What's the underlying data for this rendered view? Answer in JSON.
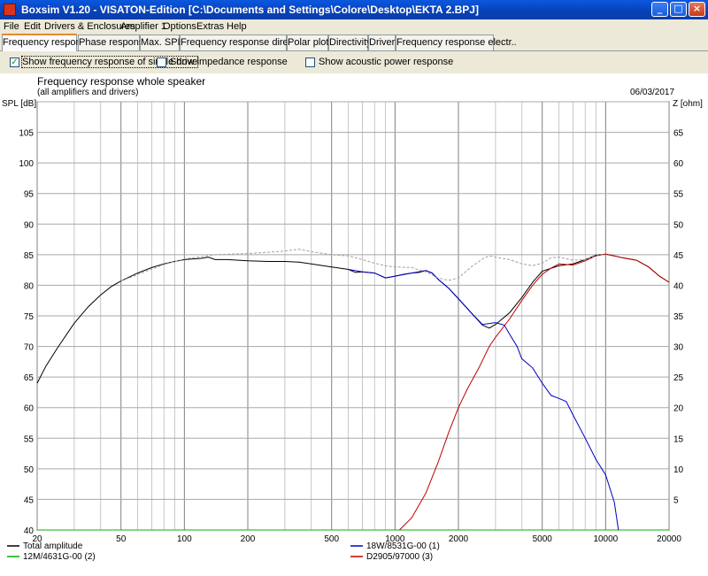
{
  "window": {
    "title": "Boxsim V1.20 - VISATON-Edition [C:\\Documents and Settings\\Colore\\Desktop\\EKTA 2.BPJ]",
    "minimize_label": "_",
    "maximize_label": "□",
    "close_label": "×"
  },
  "menu": [
    "File",
    "Edit",
    "Drivers & Enclosures",
    "Amplifier 1",
    "Options",
    "Extras",
    "Help"
  ],
  "tabs": [
    "Frequency response.",
    "Phase response",
    "Max. SPL",
    "Frequency response directions",
    "Polar plots",
    "Directivity",
    "Driver",
    "Frequency response electr.."
  ],
  "active_tab": 0,
  "options": [
    {
      "label": "Show frequency response of single drive",
      "checked": true
    },
    {
      "label": "Show impedance response",
      "checked": false
    },
    {
      "label": "Show acoustic power response",
      "checked": false
    }
  ],
  "chart_data": {
    "type": "line",
    "title": "Frequency response whole speaker",
    "subtitle": "(all amplifiers and drivers)",
    "date": "06/03/2017",
    "ylabel": "SPL [dB]",
    "ylabel_right": "Z [ohm]",
    "xscale": "log",
    "xlim": [
      20,
      20000
    ],
    "ylim": [
      40,
      110
    ],
    "ylim_right": [
      0,
      70
    ],
    "x_ticks": [
      20,
      50,
      100,
      200,
      500,
      1000,
      2000,
      5000,
      10000,
      20000
    ],
    "y_ticks": [
      40,
      45,
      50,
      55,
      60,
      65,
      70,
      75,
      80,
      85,
      90,
      95,
      100,
      105
    ],
    "y_ticks_right": [
      5,
      10,
      15,
      20,
      25,
      30,
      35,
      40,
      45,
      50,
      55,
      60,
      65
    ],
    "grid": true,
    "series": [
      {
        "name": "Total amplitude",
        "color": "#000000",
        "dash": false,
        "points": [
          [
            20,
            64
          ],
          [
            22,
            66.8
          ],
          [
            25,
            69.8
          ],
          [
            28,
            72.3
          ],
          [
            30,
            73.8
          ],
          [
            35,
            76.5
          ],
          [
            40,
            78.4
          ],
          [
            45,
            79.8
          ],
          [
            50,
            80.7
          ],
          [
            60,
            82
          ],
          [
            70,
            82.9
          ],
          [
            80,
            83.5
          ],
          [
            90,
            83.9
          ],
          [
            100,
            84.2
          ],
          [
            120,
            84.4
          ],
          [
            130,
            84.6
          ],
          [
            140,
            84.2
          ],
          [
            160,
            84.2
          ],
          [
            200,
            84
          ],
          [
            250,
            83.9
          ],
          [
            300,
            83.9
          ],
          [
            350,
            83.8
          ],
          [
            400,
            83.5
          ],
          [
            500,
            83
          ],
          [
            600,
            82.6
          ],
          [
            650,
            82.1
          ],
          [
            700,
            82.2
          ],
          [
            800,
            82
          ],
          [
            900,
            81.2
          ],
          [
            1000,
            81.5
          ],
          [
            1100,
            81.8
          ],
          [
            1200,
            82
          ],
          [
            1300,
            82.1
          ],
          [
            1400,
            82.4
          ],
          [
            1500,
            82
          ],
          [
            1600,
            81
          ],
          [
            1800,
            79.5
          ],
          [
            2000,
            77.8
          ],
          [
            2300,
            75.5
          ],
          [
            2600,
            73.5
          ],
          [
            2800,
            73
          ],
          [
            3000,
            73.6
          ],
          [
            3500,
            75.5
          ],
          [
            4000,
            78
          ],
          [
            4500,
            80.5
          ],
          [
            5000,
            82.3
          ],
          [
            6000,
            83.2
          ],
          [
            7000,
            83.5
          ],
          [
            8000,
            84.2
          ],
          [
            9000,
            84.9
          ],
          [
            10000,
            85.1
          ],
          [
            11000,
            84.8
          ],
          [
            12000,
            84.5
          ],
          [
            14000,
            84.1
          ],
          [
            16000,
            83
          ],
          [
            18000,
            81.5
          ],
          [
            20000,
            80.5
          ]
        ]
      },
      {
        "name": "12M/4631G-00 (2)",
        "color": "#00b000",
        "dash": false,
        "points": [
          [
            20,
            40
          ],
          [
            20000,
            40
          ]
        ]
      },
      {
        "name": "18W/8531G-00 (1)",
        "color": "#0000c0",
        "dash": false,
        "points": [
          [
            600,
            82.6
          ],
          [
            700,
            82.2
          ],
          [
            800,
            82
          ],
          [
            900,
            81.2
          ],
          [
            1000,
            81.5
          ],
          [
            1200,
            82
          ],
          [
            1400,
            82.4
          ],
          [
            1500,
            82
          ],
          [
            1600,
            81
          ],
          [
            1800,
            79.5
          ],
          [
            2000,
            77.8
          ],
          [
            2300,
            75.5
          ],
          [
            2600,
            73.6
          ],
          [
            3000,
            73.9
          ],
          [
            3300,
            73.5
          ],
          [
            3500,
            72
          ],
          [
            3800,
            70
          ],
          [
            4000,
            68
          ],
          [
            4500,
            66.5
          ],
          [
            5000,
            64
          ],
          [
            5500,
            62
          ],
          [
            6000,
            61.5
          ],
          [
            6500,
            61
          ],
          [
            7000,
            58.8
          ],
          [
            8000,
            55
          ],
          [
            9000,
            51.5
          ],
          [
            10000,
            49
          ],
          [
            11000,
            44.5
          ],
          [
            11500,
            40
          ]
        ]
      },
      {
        "name": "D2905/97000 (3)",
        "color": "#c00000",
        "dash": false,
        "points": [
          [
            1050,
            40
          ],
          [
            1200,
            42
          ],
          [
            1400,
            46
          ],
          [
            1600,
            51
          ],
          [
            1800,
            56
          ],
          [
            2000,
            60
          ],
          [
            2200,
            63
          ],
          [
            2500,
            66.5
          ],
          [
            2800,
            70
          ],
          [
            3000,
            71.5
          ],
          [
            3500,
            74.5
          ],
          [
            4000,
            77.5
          ],
          [
            4500,
            80
          ],
          [
            5000,
            81.8
          ],
          [
            5500,
            82.8
          ],
          [
            6000,
            83.5
          ],
          [
            7000,
            83.3
          ],
          [
            8000,
            84
          ],
          [
            9000,
            84.8
          ],
          [
            10000,
            85.1
          ],
          [
            11000,
            84.8
          ],
          [
            12000,
            84.5
          ],
          [
            14000,
            84.1
          ],
          [
            16000,
            83
          ],
          [
            18000,
            81.5
          ],
          [
            20000,
            80.5
          ]
        ]
      },
      {
        "name": "",
        "color": "#a0a0a0",
        "dash": true,
        "points": [
          [
            50,
            80.7
          ],
          [
            80,
            83.4
          ],
          [
            100,
            84.3
          ],
          [
            140,
            85
          ],
          [
            200,
            85.2
          ],
          [
            250,
            85.4
          ],
          [
            300,
            85.6
          ],
          [
            350,
            85.9
          ],
          [
            400,
            85.5
          ],
          [
            500,
            85
          ],
          [
            600,
            84.8
          ],
          [
            700,
            84.2
          ],
          [
            800,
            83.6
          ],
          [
            900,
            83.2
          ],
          [
            1000,
            83
          ],
          [
            1200,
            82.9
          ],
          [
            1400,
            82.2
          ],
          [
            1600,
            81.2
          ],
          [
            1800,
            80.8
          ],
          [
            2000,
            81.2
          ],
          [
            2300,
            83
          ],
          [
            2600,
            84.3
          ],
          [
            2800,
            84.8
          ],
          [
            3000,
            84.6
          ],
          [
            3500,
            84.2
          ],
          [
            4000,
            83.5
          ],
          [
            4500,
            83.2
          ],
          [
            5000,
            83.6
          ],
          [
            5500,
            84.5
          ],
          [
            6000,
            84.6
          ],
          [
            7000,
            84.1
          ],
          [
            8000,
            84.2
          ],
          [
            9000,
            84.8
          ],
          [
            10000,
            85.1
          ]
        ]
      }
    ],
    "legend": [
      {
        "name": "Total amplitude",
        "color": "#000000"
      },
      {
        "name": "12M/4631G-00 (2)",
        "color": "#00b000"
      },
      {
        "name": "18W/8531G-00 (1)",
        "color": "#0000c0"
      },
      {
        "name": "D2905/97000 (3)",
        "color": "#c00000"
      }
    ]
  }
}
